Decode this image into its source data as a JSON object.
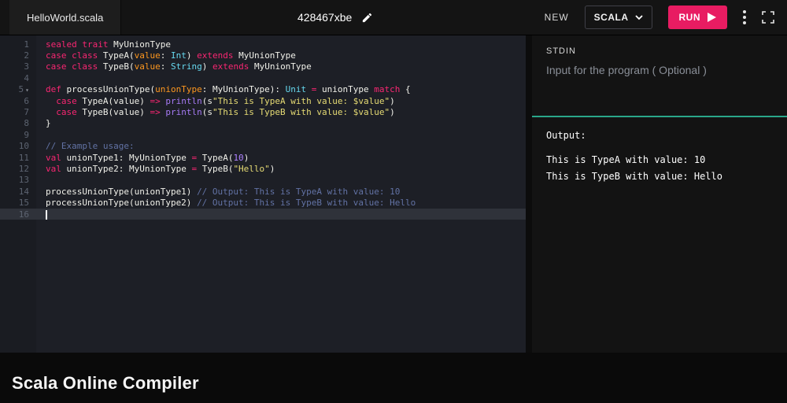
{
  "topbar": {
    "tab_label": "HelloWorld.scala",
    "project_id": "428467xbe",
    "new_label": "NEW",
    "language_selector": "SCALA",
    "run_label": "RUN"
  },
  "editor": {
    "lines": [
      {
        "n": "1",
        "tokens": [
          [
            "kw",
            "sealed trait"
          ],
          [
            "pl",
            " MyUnionType"
          ]
        ]
      },
      {
        "n": "2",
        "tokens": [
          [
            "kw",
            "case class"
          ],
          [
            "pl",
            " TypeA("
          ],
          [
            "pr",
            "value"
          ],
          [
            "pl",
            ": "
          ],
          [
            "ty",
            "Int"
          ],
          [
            "pl",
            ") "
          ],
          [
            "kw",
            "extends"
          ],
          [
            "pl",
            " MyUnionType"
          ]
        ]
      },
      {
        "n": "3",
        "tokens": [
          [
            "kw",
            "case class"
          ],
          [
            "pl",
            " TypeB("
          ],
          [
            "pr",
            "value"
          ],
          [
            "pl",
            ": "
          ],
          [
            "ty",
            "String"
          ],
          [
            "pl",
            ") "
          ],
          [
            "kw",
            "extends"
          ],
          [
            "pl",
            " MyUnionType"
          ]
        ]
      },
      {
        "n": "4",
        "tokens": []
      },
      {
        "n": "5",
        "fold": true,
        "tokens": [
          [
            "kw",
            "def"
          ],
          [
            "pl",
            " processUnionType("
          ],
          [
            "pr",
            "unionType"
          ],
          [
            "pl",
            ": MyUnionType): "
          ],
          [
            "ty",
            "Unit"
          ],
          [
            "pl",
            " "
          ],
          [
            "kw",
            "="
          ],
          [
            "pl",
            " unionType "
          ],
          [
            "kw",
            "match"
          ],
          [
            "pl",
            " {"
          ]
        ]
      },
      {
        "n": "6",
        "tokens": [
          [
            "pl",
            "  "
          ],
          [
            "kw",
            "case"
          ],
          [
            "pl",
            " TypeA(value) "
          ],
          [
            "kw",
            "=>"
          ],
          [
            "pl",
            " "
          ],
          [
            "fn",
            "println"
          ],
          [
            "pl",
            "(s"
          ],
          [
            "str",
            "\"This is TypeA with value: $value\""
          ],
          [
            "pl",
            ")"
          ]
        ]
      },
      {
        "n": "7",
        "tokens": [
          [
            "pl",
            "  "
          ],
          [
            "kw",
            "case"
          ],
          [
            "pl",
            " TypeB(value) "
          ],
          [
            "kw",
            "=>"
          ],
          [
            "pl",
            " "
          ],
          [
            "fn",
            "println"
          ],
          [
            "pl",
            "(s"
          ],
          [
            "str",
            "\"This is TypeB with value: $value\""
          ],
          [
            "pl",
            ")"
          ]
        ]
      },
      {
        "n": "8",
        "tokens": [
          [
            "pl",
            "}"
          ]
        ]
      },
      {
        "n": "9",
        "tokens": []
      },
      {
        "n": "10",
        "tokens": [
          [
            "cm",
            "// Example usage:"
          ]
        ]
      },
      {
        "n": "11",
        "tokens": [
          [
            "kw",
            "val"
          ],
          [
            "pl",
            " unionType1: MyUnionType "
          ],
          [
            "kw",
            "="
          ],
          [
            "pl",
            " TypeA("
          ],
          [
            "num",
            "10"
          ],
          [
            "pl",
            ")"
          ]
        ]
      },
      {
        "n": "12",
        "tokens": [
          [
            "kw",
            "val"
          ],
          [
            "pl",
            " unionType2: MyUnionType "
          ],
          [
            "kw",
            "="
          ],
          [
            "pl",
            " TypeB("
          ],
          [
            "str",
            "\"Hello\""
          ],
          [
            "pl",
            ")"
          ]
        ]
      },
      {
        "n": "13",
        "tokens": []
      },
      {
        "n": "14",
        "tokens": [
          [
            "pl",
            "processUnionType(unionType1) "
          ],
          [
            "cm",
            "// Output: This is TypeA with value: 10"
          ]
        ]
      },
      {
        "n": "15",
        "tokens": [
          [
            "pl",
            "processUnionType(unionType2) "
          ],
          [
            "cm",
            "// Output: This is TypeB with value: Hello"
          ]
        ]
      },
      {
        "n": "16",
        "active": true,
        "cursor": true,
        "tokens": []
      }
    ]
  },
  "stdin": {
    "label": "STDIN",
    "placeholder": "Input for the program ( Optional )"
  },
  "output": {
    "label": "Output:",
    "lines": [
      "This is TypeA with value: 10",
      "This is TypeB with value: Hello"
    ]
  },
  "footer": {
    "title": "Scala Online Compiler"
  },
  "colors": {
    "run_button": "#e81c62",
    "stdin_divider": "#2aa78a",
    "keyword": "#f92672",
    "string": "#e6db74",
    "comment": "#6272a4",
    "type": "#66d9ef",
    "number": "#ae81ff"
  }
}
